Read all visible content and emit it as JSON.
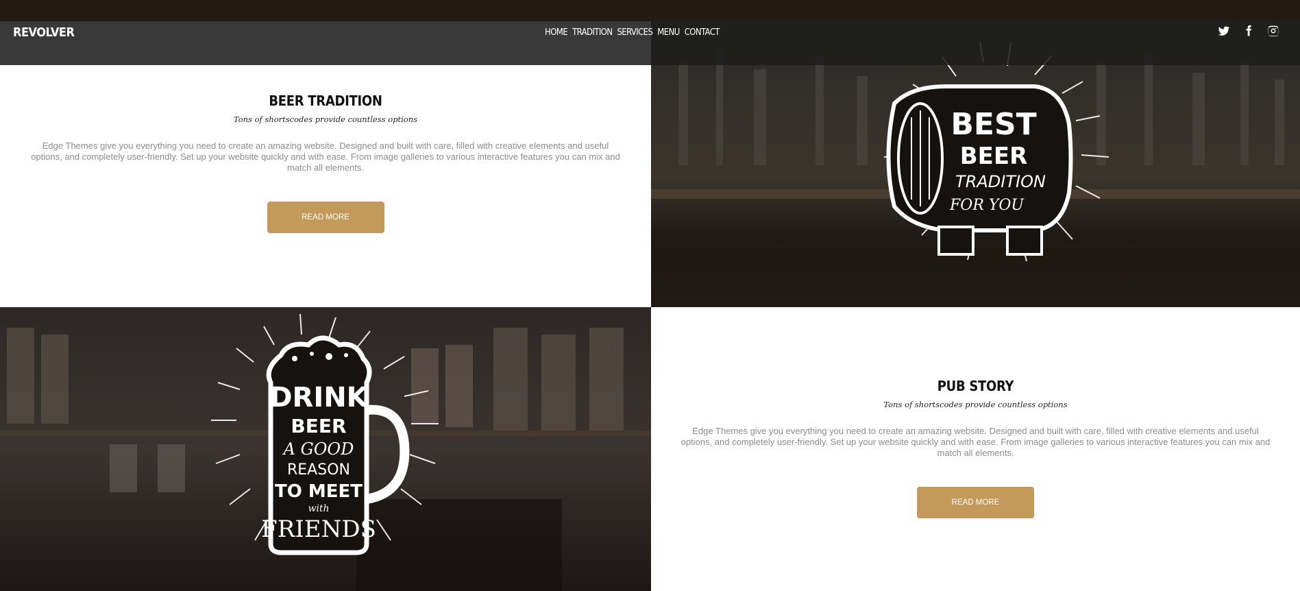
{
  "header": {
    "logo": "REVOLVER",
    "nav": [
      "HOME",
      "TRADITION",
      "SERVICES",
      "MENU",
      "CONTACT"
    ],
    "socials": [
      "twitter-icon",
      "facebook-icon",
      "instagram-icon"
    ]
  },
  "tradition": {
    "title": "BEER TRADITION",
    "subtitle": "Tons of shortscodes provide countless options",
    "body": "Edge Themes give you everything you need to create an amazing website. Designed and built with care, filled with creative elements and useful options, and completely user-friendly. Set up your website quickly and with ease. From image galleries to various interactive features you can mix and match all elements.",
    "button": "READ MORE"
  },
  "barrel": {
    "lines": [
      "BEST",
      "BEER",
      "TRADITION",
      "FOR YOU"
    ]
  },
  "mug": {
    "lines": [
      "DRINK",
      "BEER",
      "A GOOD",
      "REASON",
      "TO MEET",
      "with",
      "FRIENDS"
    ]
  },
  "story": {
    "title": "PUB STORY",
    "subtitle": "Tons of shortscodes provide countless options",
    "body": "Edge Themes give you everything you need to create an amazing website. Designed and built with care, filled with creative elements and useful options, and completely user-friendly. Set up your website quickly and with ease. From image galleries to various interactive features you can mix and match all elements.",
    "button": "READ MORE"
  },
  "colors": {
    "accent": "#c49a5a",
    "header": "#1e1e1e",
    "top_strip": "#241c12"
  }
}
